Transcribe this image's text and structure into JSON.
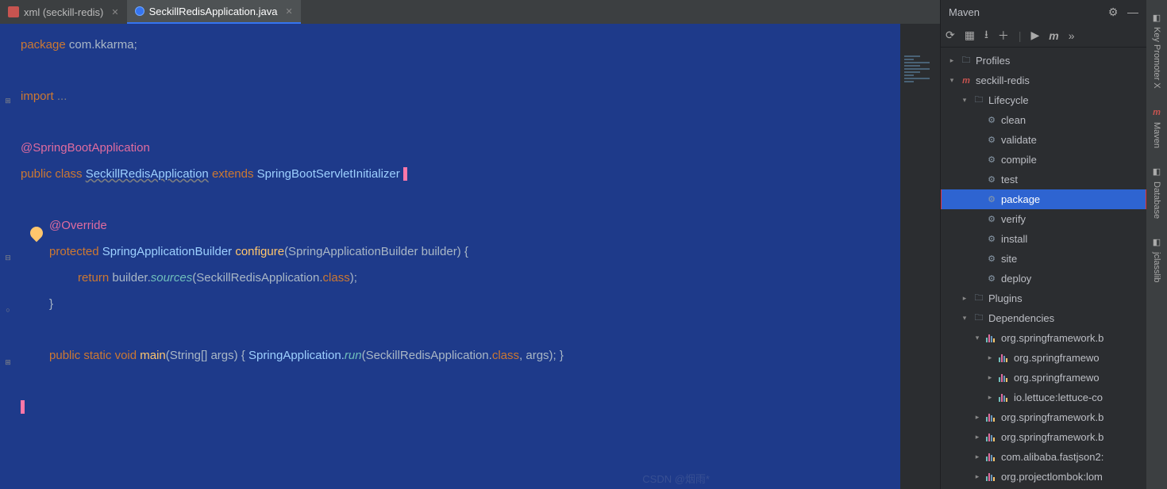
{
  "tabs": [
    {
      "label": "xml (seckill-redis)",
      "active": false,
      "iconType": "xml"
    },
    {
      "label": "SeckillRedisApplication.java",
      "active": true,
      "iconType": "java"
    }
  ],
  "inspection": {
    "warnings": "1",
    "passes": "1"
  },
  "code": {
    "l1_package": "package",
    "l1_pkg": " com.kkarma;",
    "l3_import": "import",
    "l3_rest": " ...",
    "l5_anno": "@SpringBootApplication",
    "l6_public": "public ",
    "l6_class": "class ",
    "l6_name": "SeckillRedisApplication",
    "l6_extends": " extends ",
    "l6_super": "SpringBootServletInitializer ",
    "l6_brace": "{",
    "l8_override": "@Override",
    "l9_protected": "protected ",
    "l9_ret": "SpringApplicationBuilder ",
    "l9_method": "configure",
    "l9_params": "(SpringApplicationBuilder builder) {",
    "l10_return": "return",
    "l10_expr_a": " builder.",
    "l10_sources": "sources",
    "l10_expr_b": "(SeckillRedisApplication.",
    "l10_class": "class",
    "l10_expr_c": ");",
    "l11_close": "}",
    "l13_public": "public ",
    "l13_static": "static ",
    "l13_void": "void ",
    "l13_main": "main",
    "l13_params": "(String[] args) { ",
    "l13_app": "SpringApplication.",
    "l13_run": "run",
    "l13_args_a": "(SeckillRedisApplication.",
    "l13_class": "class",
    "l13_args_b": ", args); }",
    "l15_close": "}"
  },
  "maven": {
    "title": "Maven",
    "tree": [
      {
        "depth": 0,
        "arrow": "closed",
        "icon": "folder",
        "label": "Profiles"
      },
      {
        "depth": 0,
        "arrow": "open",
        "icon": "m",
        "label": "seckill-redis"
      },
      {
        "depth": 1,
        "arrow": "open",
        "icon": "folder",
        "label": "Lifecycle"
      },
      {
        "depth": 2,
        "arrow": "none",
        "icon": "gear",
        "label": "clean"
      },
      {
        "depth": 2,
        "arrow": "none",
        "icon": "gear",
        "label": "validate"
      },
      {
        "depth": 2,
        "arrow": "none",
        "icon": "gear",
        "label": "compile"
      },
      {
        "depth": 2,
        "arrow": "none",
        "icon": "gear",
        "label": "test"
      },
      {
        "depth": 2,
        "arrow": "none",
        "icon": "gear",
        "label": "package",
        "selected": true,
        "highlight": true
      },
      {
        "depth": 2,
        "arrow": "none",
        "icon": "gear",
        "label": "verify"
      },
      {
        "depth": 2,
        "arrow": "none",
        "icon": "gear",
        "label": "install"
      },
      {
        "depth": 2,
        "arrow": "none",
        "icon": "gear",
        "label": "site"
      },
      {
        "depth": 2,
        "arrow": "none",
        "icon": "gear",
        "label": "deploy"
      },
      {
        "depth": 1,
        "arrow": "closed",
        "icon": "folder",
        "label": "Plugins"
      },
      {
        "depth": 1,
        "arrow": "open",
        "icon": "folder",
        "label": "Dependencies"
      },
      {
        "depth": 2,
        "arrow": "open",
        "icon": "bars",
        "label": "org.springframework.b"
      },
      {
        "depth": 3,
        "arrow": "closed",
        "icon": "bars",
        "label": "org.springframewo"
      },
      {
        "depth": 3,
        "arrow": "closed",
        "icon": "bars",
        "label": "org.springframewo"
      },
      {
        "depth": 3,
        "arrow": "closed",
        "icon": "bars",
        "label": "io.lettuce:lettuce-co"
      },
      {
        "depth": 2,
        "arrow": "closed",
        "icon": "bars",
        "label": "org.springframework.b"
      },
      {
        "depth": 2,
        "arrow": "closed",
        "icon": "bars",
        "label": "org.springframework.b"
      },
      {
        "depth": 2,
        "arrow": "closed",
        "icon": "bars",
        "label": "com.alibaba.fastjson2:"
      },
      {
        "depth": 2,
        "arrow": "closed",
        "icon": "bars",
        "label": "org.projectlombok:lom"
      }
    ]
  },
  "rightTools": [
    {
      "label": "Key Promoter X"
    },
    {
      "label": "Maven"
    },
    {
      "label": "Database"
    },
    {
      "label": "jclasslib"
    }
  ],
  "watermark": "CSDN @烟雨*"
}
